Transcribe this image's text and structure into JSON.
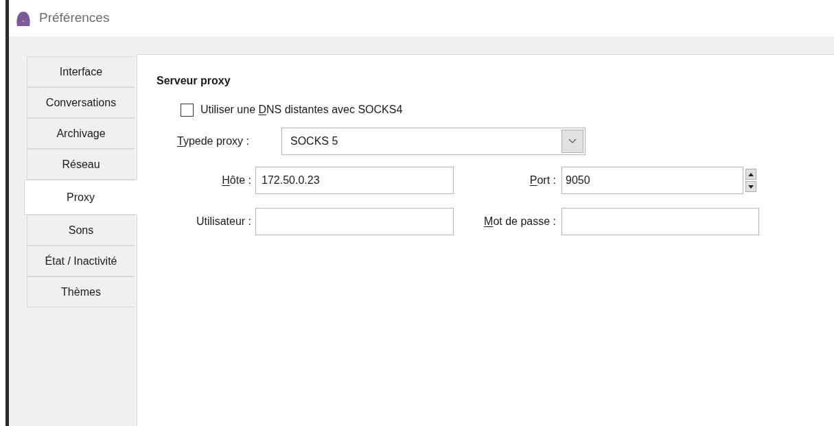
{
  "window": {
    "title": "Préférences"
  },
  "tabs": [
    {
      "label": "Interface",
      "selected": false
    },
    {
      "label": "Conversations",
      "selected": false
    },
    {
      "label": "Archivage",
      "selected": false
    },
    {
      "label": "Réseau",
      "selected": false
    },
    {
      "label": "Proxy",
      "selected": true
    },
    {
      "label": "Sons",
      "selected": false
    },
    {
      "label": "État / Inactivité",
      "selected": false
    },
    {
      "label": "Thèmes",
      "selected": false
    }
  ],
  "section": {
    "title": "Serveur proxy"
  },
  "dns_checkbox": {
    "label": [
      {
        "text": "Utiliser une ",
        "underline": false
      },
      {
        "text": "D",
        "underline": true
      },
      {
        "text": "NS distantes avec SOCKS4",
        "underline": false
      }
    ],
    "checked": false
  },
  "proxy_type": {
    "label": [
      {
        "text": "T",
        "underline": true
      },
      {
        "text": "ypede proxy :",
        "underline": false
      }
    ],
    "value": "SOCKS 5"
  },
  "host": {
    "label": [
      {
        "text": "H",
        "underline": true
      },
      {
        "text": "ôte :",
        "underline": false
      }
    ],
    "value": "172.50.0.23"
  },
  "port": {
    "label": [
      {
        "text": "P",
        "underline": true
      },
      {
        "text": "ort :",
        "underline": false
      }
    ],
    "value": "9050"
  },
  "user": {
    "label": [
      {
        "text": "Utilisateur :",
        "underline": false
      }
    ]
  },
  "password": {
    "label": [
      {
        "text": "M",
        "underline": true
      },
      {
        "text": "ot de passe :",
        "underline": false
      }
    ]
  }
}
